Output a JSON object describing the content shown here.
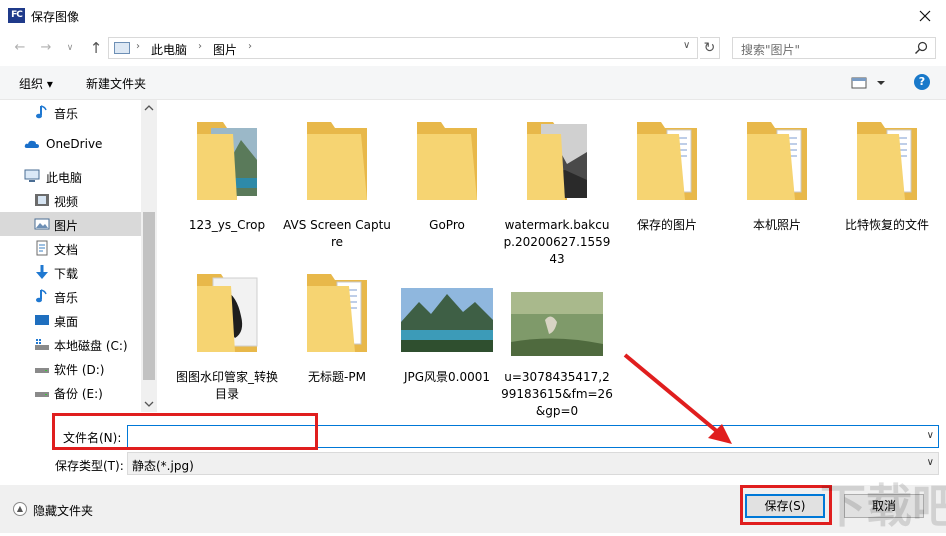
{
  "window": {
    "title": "保存图像",
    "app_icon_text": "FC"
  },
  "address": {
    "crumbs": [
      "此电脑",
      "图片"
    ]
  },
  "search": {
    "placeholder": "搜索\"图片\""
  },
  "toolbar": {
    "organize": "组织 ▾",
    "new_folder": "新建文件夹",
    "help": "?"
  },
  "nav": {
    "items": [
      {
        "label": "音乐",
        "icon": "music-note-icon"
      },
      {
        "label": "OneDrive",
        "icon": "cloud-icon"
      },
      {
        "label": "此电脑",
        "icon": "computer-icon"
      },
      {
        "label": "视频",
        "icon": "video-icon"
      },
      {
        "label": "图片",
        "icon": "pictures-icon",
        "selected": true
      },
      {
        "label": "文档",
        "icon": "document-icon"
      },
      {
        "label": "下载",
        "icon": "download-arrow-icon"
      },
      {
        "label": "音乐",
        "icon": "music-note-icon"
      },
      {
        "label": "桌面",
        "icon": "desktop-icon"
      },
      {
        "label": "本地磁盘 (C:)",
        "icon": "drive-c-icon"
      },
      {
        "label": "软件 (D:)",
        "icon": "drive-icon"
      },
      {
        "label": "备份 (E:)",
        "icon": "drive-icon"
      }
    ]
  },
  "files": [
    {
      "label": "123_ys_Crop",
      "kind": "folder-photo"
    },
    {
      "label": "AVS Screen Capture",
      "kind": "folder"
    },
    {
      "label": "GoPro",
      "kind": "folder"
    },
    {
      "label": "watermark.bakcup.20200627.155943",
      "kind": "folder-bw"
    },
    {
      "label": "保存的图片",
      "kind": "folder-docs"
    },
    {
      "label": "本机照片",
      "kind": "folder-docs"
    },
    {
      "label": "比特恢复的文件",
      "kind": "folder-docs"
    },
    {
      "label": "图图水印管家_转换目录",
      "kind": "folder-earphone"
    },
    {
      "label": "无标题-PM",
      "kind": "folder-docs"
    },
    {
      "label": "JPG风景0.0001",
      "kind": "image-landscape"
    },
    {
      "label": "u=3078435417,299183615&fm=26&gp=0",
      "kind": "image-green"
    }
  ],
  "form": {
    "filename_label": "文件名(N):",
    "filename_value": "",
    "filetype_label": "保存类型(T):",
    "filetype_value": "静态(*.jpg)"
  },
  "footer": {
    "hide_folders": "隐藏文件夹",
    "save": "保存(S)",
    "cancel": "取消"
  },
  "colors": {
    "accent": "#0078d7",
    "annotation": "#e01e1e",
    "folder": "#f6d472",
    "selected": "#d9d9d9"
  }
}
